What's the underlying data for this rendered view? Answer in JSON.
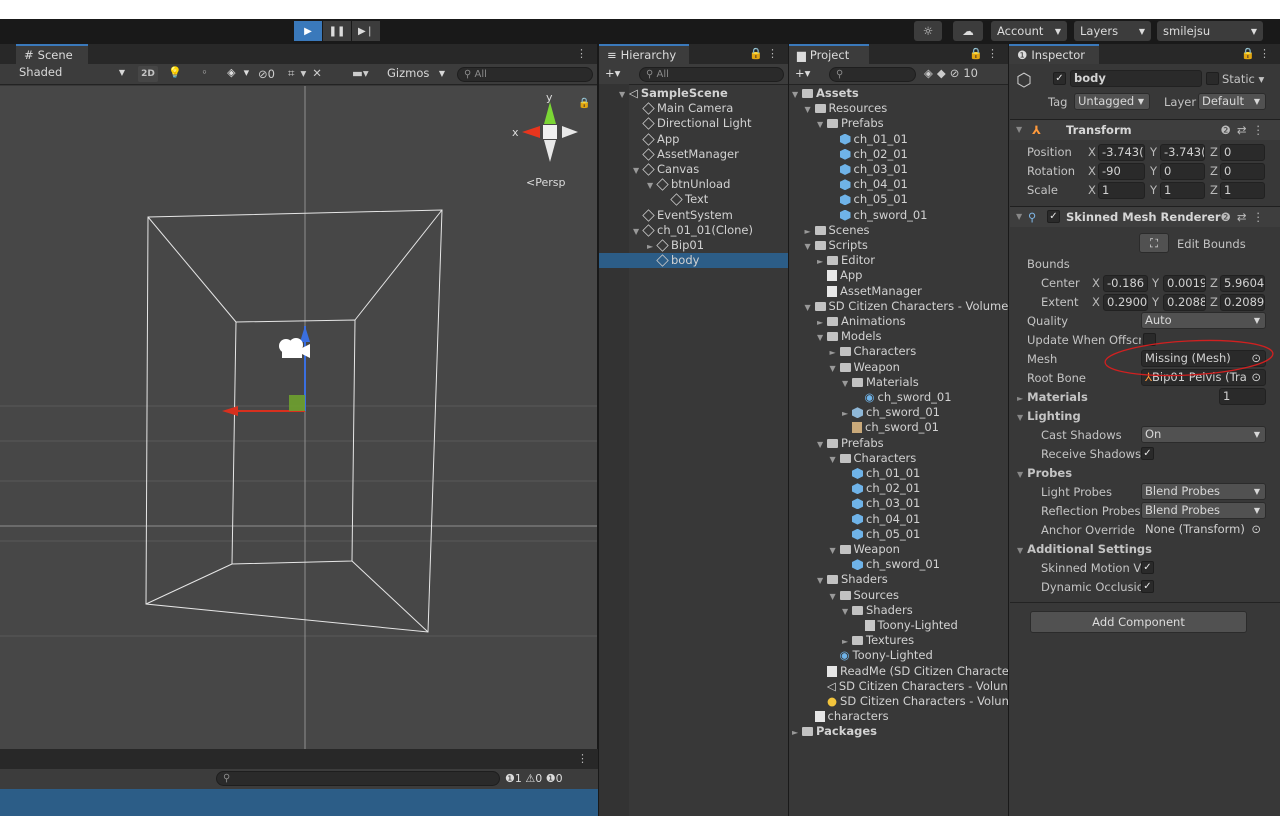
{
  "toolbar": {
    "account": "Account",
    "layers": "Layers",
    "user": "smilejsu"
  },
  "scene": {
    "tab": "Scene",
    "shading": "Shaded",
    "mode_2d": "2D",
    "gizmo_count": "0",
    "gizmos": "Gizmos",
    "search_placeholder": "All",
    "persp": "Persp",
    "axis_x": "x",
    "axis_y": "y"
  },
  "hierarchy": {
    "tab": "Hierarchy",
    "search_placeholder": "All",
    "items": [
      {
        "label": "SampleScene",
        "depth": 0,
        "caret": "▼",
        "icon": "scene-icon",
        "bold": true
      },
      {
        "label": "Main Camera",
        "depth": 1,
        "caret": "",
        "icon": "gameobject-icon"
      },
      {
        "label": "Directional Light",
        "depth": 1,
        "caret": "",
        "icon": "gameobject-icon"
      },
      {
        "label": "App",
        "depth": 1,
        "caret": "",
        "icon": "gameobject-icon"
      },
      {
        "label": "AssetManager",
        "depth": 1,
        "caret": "",
        "icon": "gameobject-icon"
      },
      {
        "label": "Canvas",
        "depth": 1,
        "caret": "▼",
        "icon": "gameobject-icon"
      },
      {
        "label": "btnUnload",
        "depth": 2,
        "caret": "▼",
        "icon": "gameobject-icon"
      },
      {
        "label": "Text",
        "depth": 3,
        "caret": "",
        "icon": "gameobject-icon"
      },
      {
        "label": "EventSystem",
        "depth": 1,
        "caret": "",
        "icon": "gameobject-icon"
      },
      {
        "label": "ch_01_01(Clone)",
        "depth": 1,
        "caret": "▼",
        "icon": "gameobject-icon"
      },
      {
        "label": "Bip01",
        "depth": 2,
        "caret": "►",
        "icon": "gameobject-icon"
      },
      {
        "label": "body",
        "depth": 2,
        "caret": "",
        "icon": "gameobject-icon",
        "selected": true
      }
    ]
  },
  "project": {
    "tab": "Project",
    "hidden_count": "10",
    "items": [
      {
        "label": "Assets",
        "depth": 0,
        "caret": "▼",
        "icon": "folder-icon",
        "bold": true
      },
      {
        "label": "Resources",
        "depth": 1,
        "caret": "▼",
        "icon": "folder-icon"
      },
      {
        "label": "Prefabs",
        "depth": 2,
        "caret": "▼",
        "icon": "folder-icon"
      },
      {
        "label": "ch_01_01",
        "depth": 3,
        "caret": "",
        "icon": "prefab-icon"
      },
      {
        "label": "ch_02_01",
        "depth": 3,
        "caret": "",
        "icon": "prefab-icon"
      },
      {
        "label": "ch_03_01",
        "depth": 3,
        "caret": "",
        "icon": "prefab-icon"
      },
      {
        "label": "ch_04_01",
        "depth": 3,
        "caret": "",
        "icon": "prefab-icon"
      },
      {
        "label": "ch_05_01",
        "depth": 3,
        "caret": "",
        "icon": "prefab-icon"
      },
      {
        "label": "ch_sword_01",
        "depth": 3,
        "caret": "",
        "icon": "prefab-icon"
      },
      {
        "label": "Scenes",
        "depth": 1,
        "caret": "►",
        "icon": "folder-icon"
      },
      {
        "label": "Scripts",
        "depth": 1,
        "caret": "▼",
        "icon": "folder-icon"
      },
      {
        "label": "Editor",
        "depth": 2,
        "caret": "►",
        "icon": "folder-icon"
      },
      {
        "label": "App",
        "depth": 2,
        "caret": "",
        "icon": "script-icon"
      },
      {
        "label": "AssetManager",
        "depth": 2,
        "caret": "",
        "icon": "script-icon"
      },
      {
        "label": "SD Citizen Characters - Volume",
        "depth": 1,
        "caret": "▼",
        "icon": "folder-icon"
      },
      {
        "label": "Animations",
        "depth": 2,
        "caret": "►",
        "icon": "folder-icon"
      },
      {
        "label": "Models",
        "depth": 2,
        "caret": "▼",
        "icon": "folder-icon"
      },
      {
        "label": "Characters",
        "depth": 3,
        "caret": "►",
        "icon": "folder-icon"
      },
      {
        "label": "Weapon",
        "depth": 3,
        "caret": "▼",
        "icon": "folder-icon"
      },
      {
        "label": "Materials",
        "depth": 4,
        "caret": "▼",
        "icon": "folder-icon"
      },
      {
        "label": "ch_sword_01",
        "depth": 5,
        "caret": "",
        "icon": "material-icon"
      },
      {
        "label": "ch_sword_01",
        "depth": 4,
        "caret": "►",
        "icon": "model-icon"
      },
      {
        "label": "ch_sword_01",
        "depth": 4,
        "caret": "",
        "icon": "texture-icon"
      },
      {
        "label": "Prefabs",
        "depth": 2,
        "caret": "▼",
        "icon": "folder-icon"
      },
      {
        "label": "Characters",
        "depth": 3,
        "caret": "▼",
        "icon": "folder-icon"
      },
      {
        "label": "ch_01_01",
        "depth": 4,
        "caret": "",
        "icon": "prefab-icon"
      },
      {
        "label": "ch_02_01",
        "depth": 4,
        "caret": "",
        "icon": "prefab-icon"
      },
      {
        "label": "ch_03_01",
        "depth": 4,
        "caret": "",
        "icon": "prefab-icon"
      },
      {
        "label": "ch_04_01",
        "depth": 4,
        "caret": "",
        "icon": "prefab-icon"
      },
      {
        "label": "ch_05_01",
        "depth": 4,
        "caret": "",
        "icon": "prefab-icon"
      },
      {
        "label": "Weapon",
        "depth": 3,
        "caret": "▼",
        "icon": "folder-icon"
      },
      {
        "label": "ch_sword_01",
        "depth": 4,
        "caret": "",
        "icon": "prefab-icon"
      },
      {
        "label": "Shaders",
        "depth": 2,
        "caret": "▼",
        "icon": "folder-icon"
      },
      {
        "label": "Sources",
        "depth": 3,
        "caret": "▼",
        "icon": "folder-icon"
      },
      {
        "label": "Shaders",
        "depth": 4,
        "caret": "▼",
        "icon": "folder-icon"
      },
      {
        "label": "Toony-Lighted",
        "depth": 5,
        "caret": "",
        "icon": "shader-icon"
      },
      {
        "label": "Textures",
        "depth": 4,
        "caret": "►",
        "icon": "folder-icon"
      },
      {
        "label": "Toony-Lighted",
        "depth": 3,
        "caret": "",
        "icon": "material-icon"
      },
      {
        "label": "ReadMe (SD Citizen Characte",
        "depth": 2,
        "caret": "",
        "icon": "document-icon"
      },
      {
        "label": "SD Citizen Characters - Volun",
        "depth": 2,
        "caret": "",
        "icon": "scene-icon"
      },
      {
        "label": "SD Citizen Characters - Volun",
        "depth": 2,
        "caret": "",
        "icon": "lighting-icon"
      },
      {
        "label": "characters",
        "depth": 1,
        "caret": "",
        "icon": "document-icon"
      },
      {
        "label": "Packages",
        "depth": 0,
        "caret": "►",
        "icon": "folder-icon",
        "bold": true
      }
    ]
  },
  "inspector": {
    "tab": "Inspector",
    "name": "body",
    "static_label": "Static",
    "tag_label": "Tag",
    "tag_value": "Untagged",
    "layer_label": "Layer",
    "layer_value": "Default",
    "transform": {
      "title": "Transform",
      "position_label": "Position",
      "rotation_label": "Rotation",
      "scale_label": "Scale",
      "position": {
        "x": "-3.743(",
        "y": "-3.743(",
        "z": "0"
      },
      "rotation": {
        "x": "-90",
        "y": "0",
        "z": "0"
      },
      "scale": {
        "x": "1",
        "y": "1",
        "z": "1"
      }
    },
    "smr": {
      "title": "Skinned Mesh Renderer",
      "edit_bounds": "Edit Bounds",
      "bounds_label": "Bounds",
      "center_label": "Center",
      "extent_label": "Extent",
      "center": {
        "x": "-0.186",
        "y": "0.0019",
        "z": "5.9604"
      },
      "extent": {
        "x": "0.2900",
        "y": "0.2088",
        "z": "0.2089"
      },
      "quality_label": "Quality",
      "quality_value": "Auto",
      "update_offscreen_label": "Update When Offscre",
      "mesh_label": "Mesh",
      "mesh_value": "Missing (Mesh)",
      "root_bone_label": "Root Bone",
      "root_bone_value": "Bip01 Pelvis (Tra",
      "materials_label": "Materials",
      "materials_count": "1",
      "lighting_label": "Lighting",
      "cast_shadows_label": "Cast Shadows",
      "cast_shadows_value": "On",
      "receive_shadows_label": "Receive Shadows",
      "probes_label": "Probes",
      "light_probes_label": "Light Probes",
      "light_probes_value": "Blend Probes",
      "reflection_probes_label": "Reflection Probes",
      "reflection_probes_value": "Blend Probes",
      "anchor_override_label": "Anchor Override",
      "anchor_override_value": "None (Transform)",
      "additional_label": "Additional Settings",
      "skinned_motion_label": "Skinned Motion Ve",
      "dynamic_occlusion_label": "Dynamic Occlusioi"
    },
    "add_component": "Add Component"
  },
  "console": {
    "error_count": "1",
    "warning_count": "0",
    "info_count": "0"
  },
  "colors": {
    "accent": "#3a79bb",
    "selection": "#2c5d87",
    "annotation": "#d12020"
  }
}
